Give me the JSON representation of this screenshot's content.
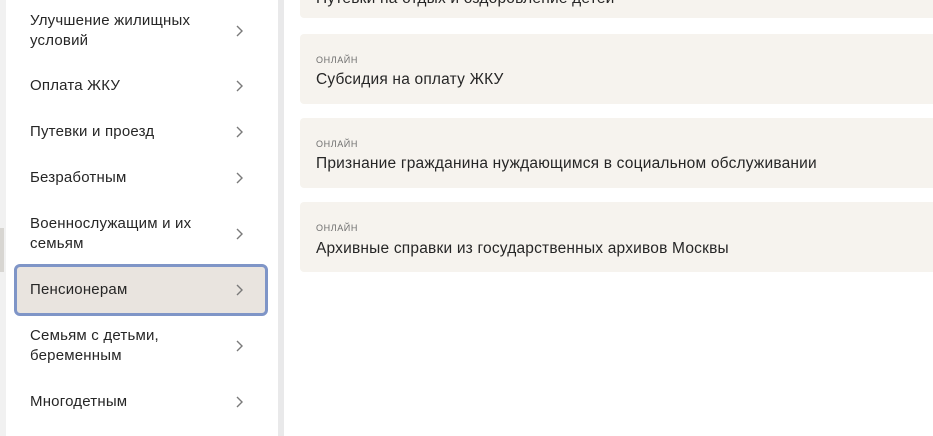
{
  "sidebar": {
    "items": [
      {
        "label": "Улучшение жилищных\nусловий"
      },
      {
        "label": "Оплата ЖКУ"
      },
      {
        "label": "Путевки и проезд"
      },
      {
        "label": "Безработным"
      },
      {
        "label": "Военнослужащим и их\nсемьям"
      },
      {
        "label": "Пенсионерам",
        "active": true
      },
      {
        "label": "Семьям с детьми,\nбеременным"
      },
      {
        "label": "Многодетным"
      }
    ]
  },
  "services": {
    "cards": [
      {
        "badge": "",
        "title": "Путевки на отдых и оздоровление детей"
      },
      {
        "badge": "ОНЛАЙН",
        "title": "Субсидия на оплату ЖКУ"
      },
      {
        "badge": "ОНЛАЙН",
        "title": "Признание гражданина нуждающимся в социальном обслуживании"
      },
      {
        "badge": "ОНЛАЙН",
        "title": "Архивные справки из государственных архивов Москвы"
      }
    ]
  },
  "colors": {
    "card_bg": "#f6f3ee",
    "active_bg": "#e9e4df",
    "active_border": "#7f95c7"
  },
  "icons": {
    "chevron": "chevron-right-icon"
  }
}
